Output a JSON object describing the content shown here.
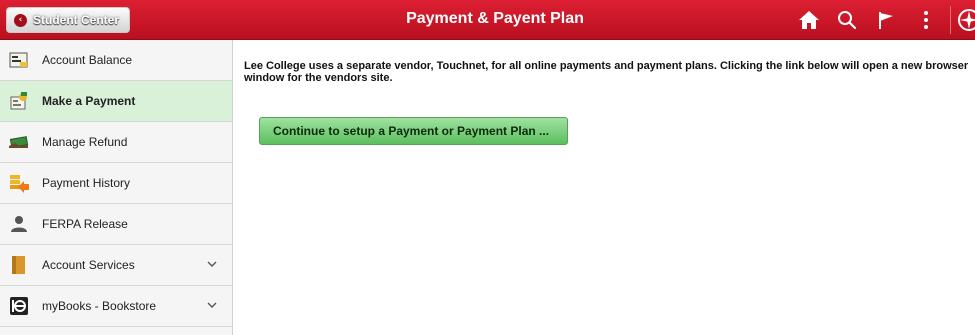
{
  "header": {
    "back_label": "Student Center",
    "title": "Payment & Payent Plan",
    "icons": [
      "home-icon",
      "search-icon",
      "flag-icon",
      "more-vertical-icon",
      "navbar-compass-icon"
    ],
    "accent_color": "#cc1528"
  },
  "sidebar": {
    "items": [
      {
        "label": "Account Balance",
        "icon": "account-balance-icon",
        "active": false,
        "expandable": false
      },
      {
        "label": "Make a Payment",
        "icon": "make-payment-icon",
        "active": true,
        "expandable": false
      },
      {
        "label": "Manage Refund",
        "icon": "refund-icon",
        "active": false,
        "expandable": false
      },
      {
        "label": "Payment History",
        "icon": "payment-history-icon",
        "active": false,
        "expandable": false
      },
      {
        "label": "FERPA Release",
        "icon": "person-icon",
        "active": false,
        "expandable": false
      },
      {
        "label": "Account Services",
        "icon": "folder-icon",
        "active": false,
        "expandable": true
      },
      {
        "label": "myBooks - Bookstore",
        "icon": "bookstore-icon",
        "active": false,
        "expandable": true
      }
    ]
  },
  "main": {
    "info_text": "Lee College uses a separate vendor, Touchnet, for all online payments and payment plans. Clicking the link below will open a new browser window for the vendors site.",
    "continue_label": "Continue to setup a Payment or Payment Plan ..."
  }
}
